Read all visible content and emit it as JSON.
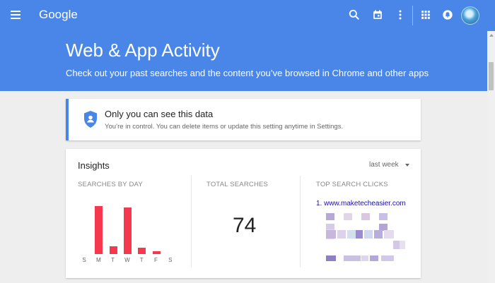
{
  "header": {
    "logo": "Google",
    "title": "Web & App Activity",
    "subtitle": "Check out your past searches and the content you’ve browsed in Chrome and other apps",
    "icons": [
      "menu-icon",
      "search-icon",
      "calendar-icon",
      "more-vert-icon",
      "apps-grid-icon",
      "notifications-icon",
      "avatar"
    ]
  },
  "privacy": {
    "title": "Only you can see this data",
    "text": "You’re in control. You can delete items or update this setting anytime in Settings."
  },
  "insights": {
    "title": "Insights",
    "range": "last week",
    "searches_by_day_label": "SEARCHES BY DAY",
    "total_searches_label": "TOTAL SEARCHES",
    "total_searches": "74",
    "top_clicks_label": "TOP SEARCH CLICKS",
    "top_click_1": "1. www.maketecheasier.com"
  },
  "chart_data": {
    "type": "bar",
    "categories": [
      "S",
      "M",
      "T",
      "W",
      "T",
      "F",
      "S"
    ],
    "values": [
      0,
      32,
      5,
      31,
      4,
      2,
      0
    ],
    "colors": {
      "bar": "#f5384e"
    }
  },
  "colors": {
    "accent": "#4a86e8",
    "bar": "#f5384e"
  }
}
